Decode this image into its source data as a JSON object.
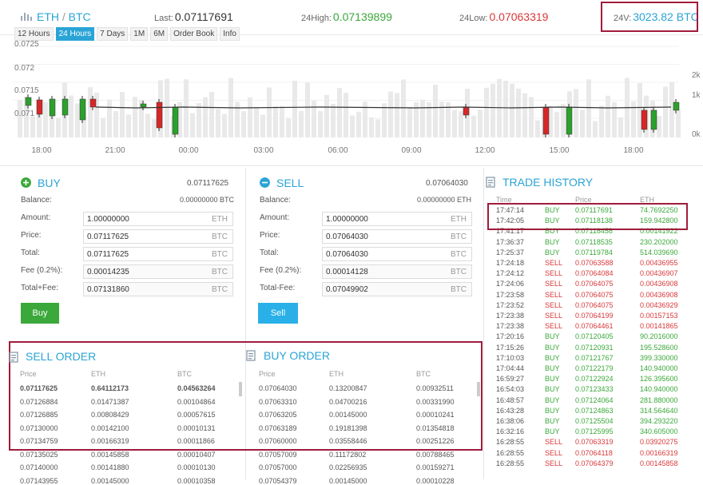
{
  "header": {
    "base": "ETH",
    "quote": "BTC",
    "last_label": "Last:",
    "last_value": "0.07117691",
    "high_label": "24High:",
    "high_value": "0.07139899",
    "low_label": "24Low:",
    "low_value": "0.07063319",
    "vol_label": "24V:",
    "vol_value": "3023.82 BTC"
  },
  "tabs": [
    "12 Hours",
    "24 Hours",
    "7 Days",
    "1M",
    "6M",
    "Order Book",
    "Info"
  ],
  "active_tab": "24 Hours",
  "chart_data": {
    "type": "candlestick",
    "y_ticks": [
      "0.0725",
      "0.072",
      "0.0715",
      "0.071"
    ],
    "volume_ticks": [
      "2k",
      "1k",
      "0k"
    ],
    "x_ticks": [
      "18:00",
      "21:00",
      "00:00",
      "03:00",
      "06:00",
      "09:00",
      "12:00",
      "15:00",
      "18:00"
    ]
  },
  "buy": {
    "title": "BUY",
    "price_top": "0.07117625",
    "balance_label": "Balance:",
    "balance_value": "0.00000000 BTC",
    "amount_label": "Amount:",
    "amount_value": "1.00000000",
    "amount_unit": "ETH",
    "price_label": "Price:",
    "price_value": "0.07117625",
    "price_unit": "BTC",
    "total_label": "Total:",
    "total_value": "0.07117625",
    "total_unit": "BTC",
    "fee_label": "Fee (0.2%):",
    "fee_value": "0.00014235",
    "fee_unit": "BTC",
    "totalfee_label": "Total+Fee:",
    "totalfee_value": "0.07131860",
    "totalfee_unit": "BTC",
    "button": "Buy"
  },
  "sell": {
    "title": "SELL",
    "price_top": "0.07064030",
    "balance_label": "Balance:",
    "balance_value": "0.00000000 ETH",
    "amount_label": "Amount:",
    "amount_value": "1.00000000",
    "amount_unit": "ETH",
    "price_label": "Price:",
    "price_value": "0.07064030",
    "price_unit": "BTC",
    "total_label": "Total:",
    "total_value": "0.07064030",
    "total_unit": "BTC",
    "fee_label": "Fee (0.2%):",
    "fee_value": "0.00014128",
    "fee_unit": "BTC",
    "totalfee_label": "Total-Fee:",
    "totalfee_value": "0.07049902",
    "totalfee_unit": "BTC",
    "button": "Sell"
  },
  "sell_order": {
    "title": "SELL ORDER",
    "headers": [
      "Price",
      "ETH",
      "BTC"
    ],
    "rows": [
      [
        "0.07117625",
        "0.64112173",
        "0.04563264"
      ],
      [
        "0.07126884",
        "0.01471387",
        "0.00104864"
      ],
      [
        "0.07126885",
        "0.00808429",
        "0.00057615"
      ],
      [
        "0.07130000",
        "0.00142100",
        "0.00010131"
      ],
      [
        "0.07134759",
        "0.00166319",
        "0.00011866"
      ],
      [
        "0.07135025",
        "0.00145858",
        "0.00010407"
      ],
      [
        "0.07140000",
        "0.00141880",
        "0.00010130"
      ],
      [
        "0.07143955",
        "0.00145000",
        "0.00010358"
      ]
    ]
  },
  "buy_order": {
    "title": "BUY ORDER",
    "headers": [
      "Price",
      "ETH",
      "BTC"
    ],
    "rows": [
      [
        "0.07064030",
        "0.13200847",
        "0.00932511"
      ],
      [
        "0.07063310",
        "0.04700216",
        "0.00331990"
      ],
      [
        "0.07063205",
        "0.00145000",
        "0.00010241"
      ],
      [
        "0.07063189",
        "0.19181398",
        "0.01354818"
      ],
      [
        "0.07060000",
        "0.03558446",
        "0.00251226"
      ],
      [
        "0.07057009",
        "0.11172802",
        "0.00788465"
      ],
      [
        "0.07057000",
        "0.02256935",
        "0.00159271"
      ],
      [
        "0.07054379",
        "0.00145000",
        "0.00010228"
      ]
    ]
  },
  "trade_history": {
    "title": "TRADE HISTORY",
    "headers": [
      "Time",
      "Price",
      "ETH"
    ],
    "rows": [
      [
        "17:47:14",
        "BUY",
        "0.07117691",
        "74.7692250"
      ],
      [
        "17:42:05",
        "BUY",
        "0.07118138",
        "159.942800"
      ],
      [
        "17:41:17",
        "BUY",
        "0.07118458",
        "0.00141922"
      ],
      [
        "17:36:37",
        "BUY",
        "0.07118535",
        "230.202000"
      ],
      [
        "17:25:37",
        "BUY",
        "0.07119784",
        "514.039690"
      ],
      [
        "17:24:18",
        "SELL",
        "0.07063588",
        "0.00436955"
      ],
      [
        "17:24:12",
        "SELL",
        "0.07064084",
        "0.00436907"
      ],
      [
        "17:24:06",
        "SELL",
        "0.07064075",
        "0.00436908"
      ],
      [
        "17:23:58",
        "SELL",
        "0.07064075",
        "0.00436908"
      ],
      [
        "17:23:52",
        "SELL",
        "0.07064075",
        "0.00436929"
      ],
      [
        "17:23:38",
        "SELL",
        "0.07064199",
        "0.00157153"
      ],
      [
        "17:23:38",
        "SELL",
        "0.07064461",
        "0.00141865"
      ],
      [
        "17:20:16",
        "BUY",
        "0.07120405",
        "90.2016000"
      ],
      [
        "17:15:26",
        "BUY",
        "0.07120931",
        "195.528600"
      ],
      [
        "17:10:03",
        "BUY",
        "0.07121767",
        "399.330000"
      ],
      [
        "17:04:44",
        "BUY",
        "0.07122179",
        "140.940000"
      ],
      [
        "16:59:27",
        "BUY",
        "0.07122924",
        "126.395600"
      ],
      [
        "16:54:03",
        "BUY",
        "0.07123433",
        "140.940000"
      ],
      [
        "16:48:57",
        "BUY",
        "0.07124064",
        "281.880000"
      ],
      [
        "16:43:28",
        "BUY",
        "0.07124863",
        "314.564640"
      ],
      [
        "16:38:06",
        "BUY",
        "0.07125504",
        "394.293220"
      ],
      [
        "16:32:16",
        "BUY",
        "0.07125995",
        "340.605000"
      ],
      [
        "16:28:55",
        "SELL",
        "0.07063319",
        "0.03920275"
      ],
      [
        "16:28:55",
        "SELL",
        "0.07064118",
        "0.00166319"
      ],
      [
        "16:28:55",
        "SELL",
        "0.07064379",
        "0.00145858"
      ]
    ]
  }
}
